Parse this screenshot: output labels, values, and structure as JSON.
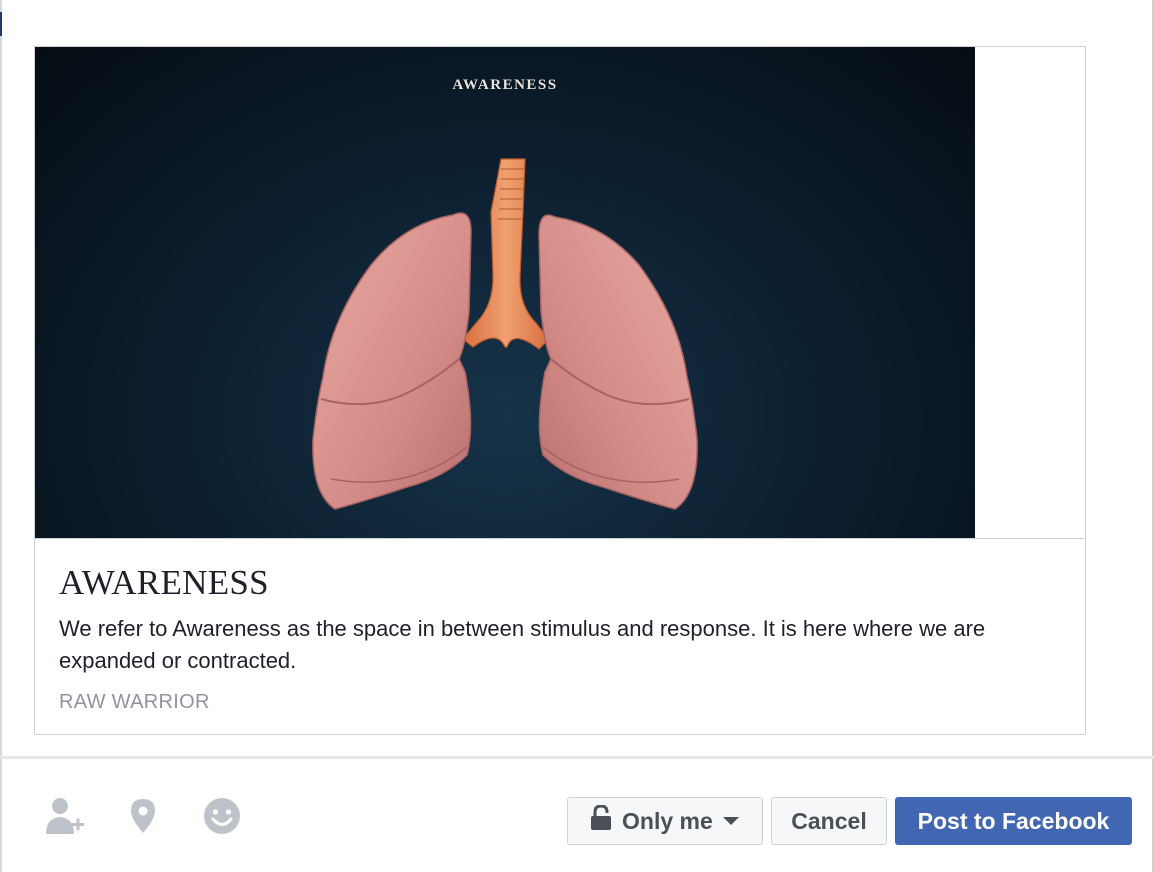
{
  "preview": {
    "image_caption": "AWARENESS",
    "title": "AWARENESS",
    "description": "We refer to Awareness as the space in between stimulus and response. It is here where we are expanded or contracted.",
    "domain": "RAW WARRIOR"
  },
  "footer": {
    "icons": [
      "tag-friends-icon",
      "location-pin-icon",
      "feeling-emoji-icon"
    ],
    "privacy_label": "Only me",
    "cancel_label": "Cancel",
    "post_label": "Post to Facebook"
  },
  "colors": {
    "primary_button": "#4267b2",
    "secondary_button": "#f6f7f9",
    "icon_gray": "#bec2c9",
    "domain_text": "#90949c",
    "image_background": "#0b1c2b"
  }
}
